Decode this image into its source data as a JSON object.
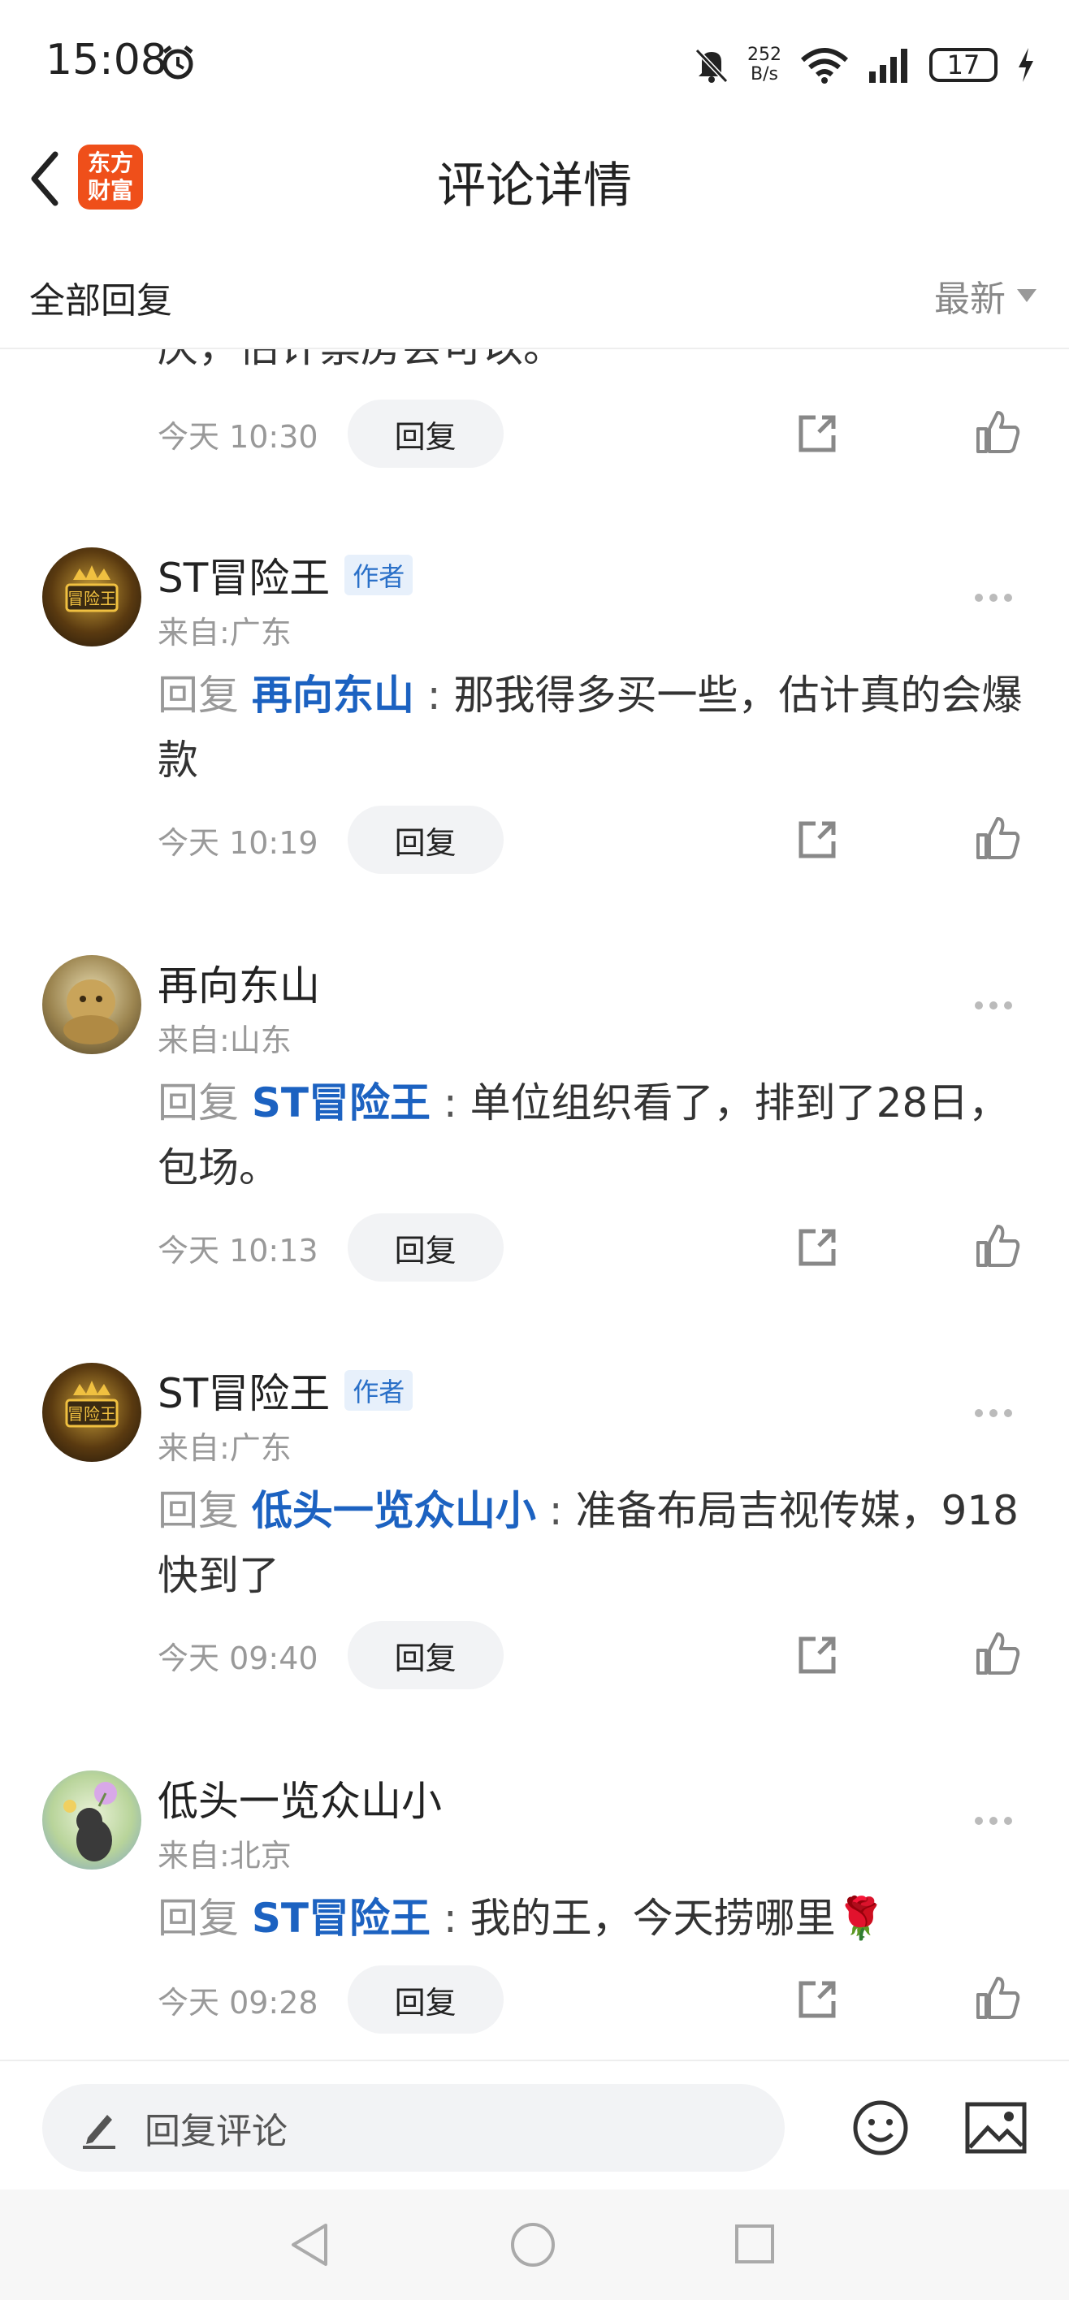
{
  "status_bar": {
    "time": "15:08",
    "net_speed_value": "252",
    "net_speed_unit": "B/s",
    "battery": "17",
    "icons": [
      "alarm-icon",
      "mute-icon",
      "wifi-icon",
      "signal-icon",
      "battery-icon",
      "charging-icon"
    ]
  },
  "nav": {
    "title": "评论详情",
    "logo_line1": "东方",
    "logo_line2": "财富"
  },
  "filter": {
    "left_label": "全部回复",
    "sort_label": "最新"
  },
  "partial_comment": {
    "text_tail": "庆，估计票房会可以。",
    "time": "今天 10:30",
    "reply_label": "回复"
  },
  "comments": [
    {
      "username": "ST冒险王",
      "author_badge": "作者",
      "location": "来自:广东",
      "reply_word": "回复",
      "target": "再向东山",
      "separator": " : ",
      "text": "那我得多买一些，估计真的会爆款",
      "time": "今天 10:19",
      "reply_label": "回复"
    },
    {
      "username": "再向东山",
      "author_badge": "",
      "location": "来自:山东",
      "reply_word": "回复",
      "target": "ST冒险王",
      "separator": " : ",
      "text": "单位组织看了，排到了28日，包场。",
      "time": "今天 10:13",
      "reply_label": "回复"
    },
    {
      "username": "ST冒险王",
      "author_badge": "作者",
      "location": "来自:广东",
      "reply_word": "回复",
      "target": "低头一览众山小",
      "separator": " : ",
      "text": "准备布局吉视传媒，918快到了",
      "time": "今天 09:40",
      "reply_label": "回复"
    },
    {
      "username": "低头一览众山小",
      "author_badge": "",
      "location": "来自:北京",
      "reply_word": "回复",
      "target": "ST冒险王",
      "separator": " : ",
      "text": "我的王，今天捞哪里🌹",
      "time": "今天 09:28",
      "reply_label": "回复"
    }
  ],
  "avatar_text": "冒险王",
  "bottom_bar": {
    "placeholder": "回复评论"
  },
  "colors": {
    "link_blue": "#1c62c1",
    "logo_orange": "#ef4f1a",
    "author_badge_bg": "#e7f0fb"
  }
}
